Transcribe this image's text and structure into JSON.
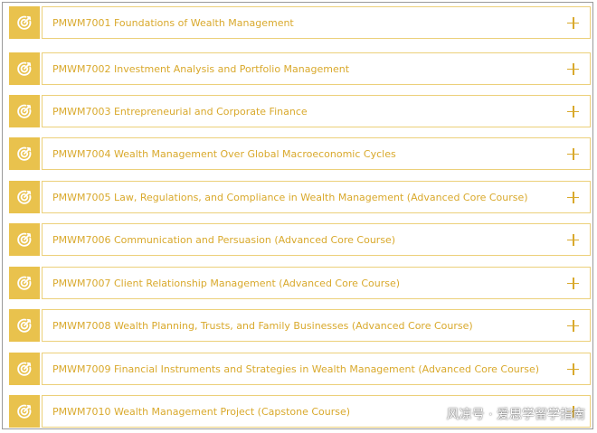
{
  "colors": {
    "accent": "#e9c24d",
    "text": "#d9a92c",
    "border": "#ecd07a"
  },
  "courses": [
    {
      "title": "PMWM7001 Foundations of Wealth Management",
      "icon": "target-icon",
      "action": "plus-icon"
    },
    {
      "title": "PMWM7002 Investment Analysis and Portfolio Management",
      "icon": "target-icon",
      "action": "plus-icon"
    },
    {
      "title": "PMWM7003 Entrepreneurial and Corporate Finance",
      "icon": "target-icon",
      "action": "plus-icon"
    },
    {
      "title": "PMWM7004 Wealth Management Over Global Macroeconomic Cycles",
      "icon": "target-icon",
      "action": "plus-icon"
    },
    {
      "title": "PMWM7005 Law, Regulations, and Compliance in Wealth Management (Advanced Core Course)",
      "icon": "target-icon",
      "action": "plus-icon"
    },
    {
      "title": "PMWM7006 Communication and Persuasion (Advanced Core Course)",
      "icon": "target-icon",
      "action": "plus-icon"
    },
    {
      "title": "PMWM7007 Client Relationship Management (Advanced Core Course)",
      "icon": "target-icon",
      "action": "plus-icon"
    },
    {
      "title": "PMWM7008 Wealth Planning, Trusts, and Family Businesses (Advanced Core Course)",
      "icon": "target-icon",
      "action": "plus-icon"
    },
    {
      "title": "PMWM7009 Financial Instruments and Strategies in Wealth Management (Advanced Core Course)",
      "icon": "target-icon",
      "action": "plus-icon"
    },
    {
      "title": "PMWM7010 Wealth Management Project (Capstone Course)",
      "icon": "target-icon",
      "action": "plus-icon"
    }
  ],
  "watermark": "风凉号 · 爱思学留学指南"
}
